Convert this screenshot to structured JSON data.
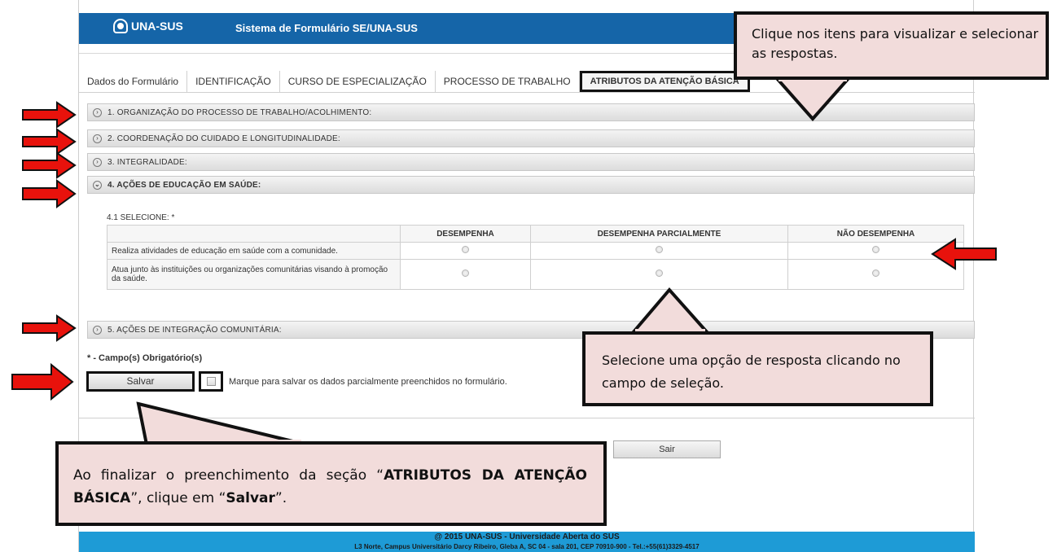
{
  "header": {
    "logo_text": "UNA-SUS",
    "system_title": "Sistema de Formulário SE/UNA-SUS"
  },
  "tabs": [
    {
      "label": "Dados do Formulário"
    },
    {
      "label": "IDENTIFICAÇÃO"
    },
    {
      "label": "CURSO DE ESPECIALIZAÇÃO"
    },
    {
      "label": "PROCESSO DE TRABALHO"
    },
    {
      "label": "ATRIBUTOS DA ATENÇÃO BÁSICA",
      "active": true
    }
  ],
  "sections": [
    {
      "label": "1. ORGANIZAÇÃO DO PROCESSO DE TRABALHO/ACOLHIMENTO:",
      "expanded": false
    },
    {
      "label": "2. COORDENAÇÃO DO CUIDADO E LONGITUDINALIDADE:",
      "expanded": false
    },
    {
      "label": "3. INTEGRALIDADE:",
      "expanded": false
    },
    {
      "label": "4. AÇÕES DE EDUCAÇÃO EM SAÚDE:",
      "expanded": true
    },
    {
      "label": "5. AÇÕES DE INTEGRAÇÃO COMUNITÁRIA:",
      "expanded": false
    }
  ],
  "question": {
    "label": "4.1 SELECIONE: *",
    "columns": [
      "",
      "DESEMPENHA",
      "DESEMPENHA PARCIALMENTE",
      "NÃO DESEMPENHA"
    ],
    "rows": [
      {
        "text": "Realiza atividades de educação em saúde com a comunidade."
      },
      {
        "text": "Atua junto às instituições ou organizações comunitárias visando à promoção da saúde."
      }
    ]
  },
  "form": {
    "required_note": "* - Campo(s) Obrigatório(s)",
    "save_label": "Salvar",
    "partial_save_label": "Marque para salvar os dados parcialmente preenchidos no formulário.",
    "exit_label": "Sair"
  },
  "footer": {
    "line1": "@ 2015 UNA-SUS - Universidade Aberta do SUS",
    "line2": "L3 Norte, Campus Universitário Darcy Ribeiro, Gleba A, SC 04 - sala 201, CEP 70910-900 - Tel.:+55(61)3329-4517"
  },
  "callouts": {
    "top": "Clique nos itens para visualizar e selecionar as respostas.",
    "middle": "Selecione uma opção de resposta clicando no campo de seleção.",
    "bottom_pre": "Ao finalizar o preenchimento da seção “",
    "bottom_bold1": "ATRIBUTOS DA ATENÇÃO BÁSICA",
    "bottom_mid": "”, clique em “",
    "bottom_bold2": "Salvar",
    "bottom_post": "”."
  },
  "colors": {
    "header_blue": "#1565a8",
    "footer_blue": "#1e9bd6",
    "callout_fill": "#f2dcdb",
    "arrow_red": "#e8120c"
  }
}
